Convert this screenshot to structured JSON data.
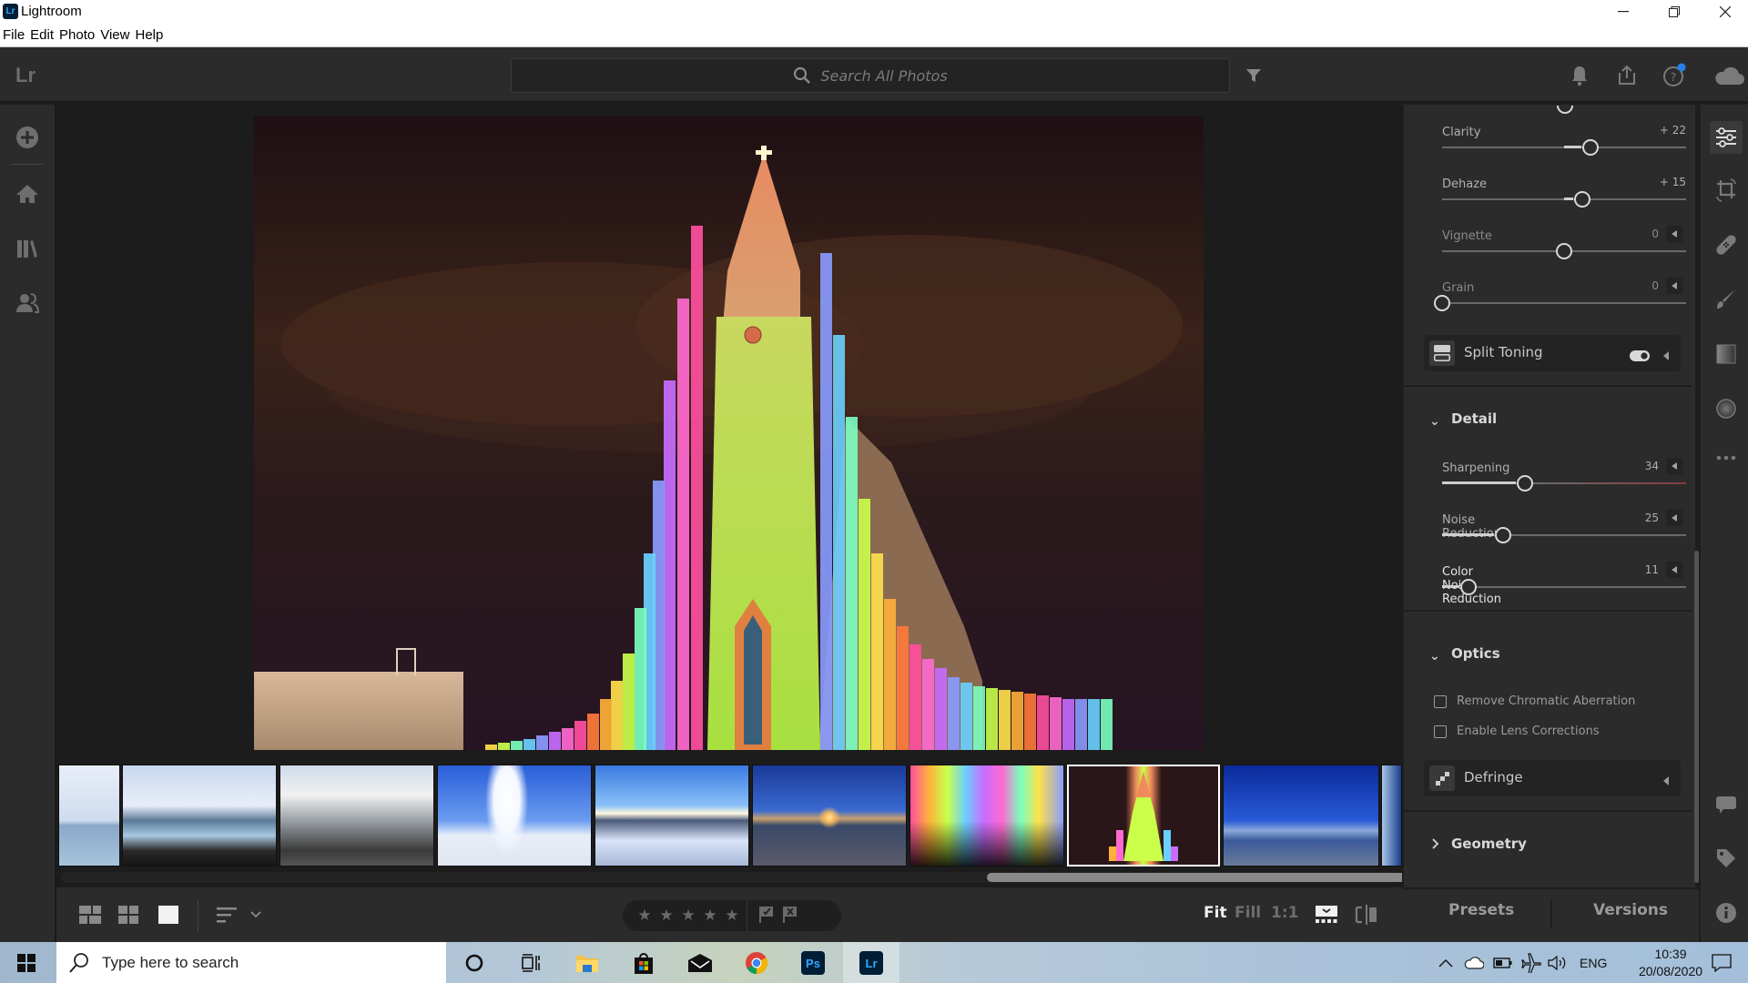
{
  "window": {
    "app_title": "Lightroom",
    "app_logo": "Lr",
    "controls": {
      "minimize": "minimize-icon",
      "restore": "restore-icon",
      "close": "close-icon"
    }
  },
  "menu": [
    "File",
    "Edit",
    "Photo",
    "View",
    "Help"
  ],
  "header": {
    "logo": "Lr",
    "search_placeholder": "Search All Photos",
    "icons": [
      "filter-icon",
      "bell-icon",
      "share-icon",
      "help-icon",
      "cloud-icon"
    ],
    "help_badge_color": "#2680eb"
  },
  "left_nav": {
    "items": [
      {
        "name": "add-photos",
        "icon": "plus-circle-icon"
      },
      {
        "name": "home",
        "icon": "home-icon"
      },
      {
        "name": "library",
        "icon": "library-icon"
      },
      {
        "name": "people",
        "icon": "people-icon"
      }
    ]
  },
  "photo": {
    "description": "Hallgrimskirkja church illuminated with rainbow light projection at night"
  },
  "filmstrip": {
    "thumbnails": [
      {
        "label": "Sky and lagoon (partial)",
        "selected": false
      },
      {
        "label": "Blue lagoon with clouds",
        "selected": false
      },
      {
        "label": "Steaming geothermal field",
        "selected": false
      },
      {
        "label": "Geyser eruption",
        "selected": false
      },
      {
        "label": "Snowy landscape at sunset",
        "selected": false
      },
      {
        "label": "Sunset over frozen shore",
        "selected": false
      },
      {
        "label": "Rainbow light columns with silhouettes",
        "selected": false
      },
      {
        "label": "Rainbow-lit church tower",
        "selected": true
      },
      {
        "label": "Sun Voyager sculpture",
        "selected": false
      },
      {
        "label": "Partial thumbnail",
        "selected": false
      }
    ]
  },
  "bottom_toolbar": {
    "view_icons": [
      "square-grid-icon",
      "photo-grid-icon",
      "single-view-icon"
    ],
    "sort_icon": "sort-icon",
    "rating_stars": 5,
    "rating_value": 0,
    "flag_icons": [
      "flag-pick-icon",
      "flag-reject-icon"
    ],
    "zoom_options": [
      "Fit",
      "Fill",
      "1:1"
    ],
    "zoom_active": "Fit",
    "filmstrip_toggle": "filmstrip-icon",
    "compare_icon": "before-after-icon"
  },
  "edit_panel": {
    "effects": [
      {
        "label": "Clarity",
        "value": "+ 22",
        "fraction": 0.61,
        "editable": true
      },
      {
        "label": "Dehaze",
        "value": "+ 15",
        "fraction": 0.575,
        "editable": true
      },
      {
        "label": "Vignette",
        "value": "0",
        "fraction": 0.5,
        "editable": false
      },
      {
        "label": "Grain",
        "value": "0",
        "fraction": 0.0,
        "editable": false
      }
    ],
    "split_toning": {
      "label": "Split Toning",
      "enabled": true
    },
    "detail": {
      "title": "Detail",
      "sliders": [
        {
          "label": "Sharpening",
          "value": "34",
          "fraction": 0.34
        },
        {
          "label": "Noise Reduction",
          "value": "25",
          "fraction": 0.25
        },
        {
          "label": "Color Noise Reduction",
          "value": "11",
          "fraction": 0.11
        }
      ]
    },
    "optics": {
      "title": "Optics",
      "checkboxes": [
        {
          "label": "Remove Chromatic Aberration",
          "checked": false
        },
        {
          "label": "Enable Lens Corrections",
          "checked": false
        }
      ],
      "defringe": "Defringe"
    },
    "geometry": {
      "title": "Geometry",
      "expanded": false
    },
    "tabs": [
      "Presets",
      "Versions"
    ]
  },
  "right_icons": [
    "edit-sliders-icon",
    "crop-icon",
    "healing-icon",
    "brush-icon",
    "linear-gradient-icon",
    "radial-gradient-icon",
    "more-icon",
    "comment-icon",
    "tag-icon",
    "info-icon"
  ],
  "taskbar": {
    "search_placeholder": "Type here to search",
    "apps": [
      "cortana-icon",
      "task-view-icon",
      "file-explorer-icon",
      "store-icon",
      "mail-icon",
      "chrome-icon",
      "photoshop-icon",
      "lightroom-icon"
    ],
    "ps_label": "Ps",
    "lr_label": "Lr",
    "language": "ENG",
    "time": "10:39",
    "date": "20/08/2020"
  }
}
